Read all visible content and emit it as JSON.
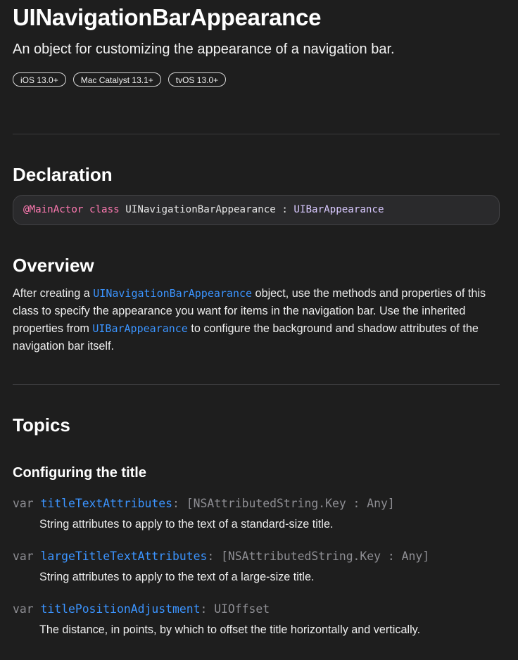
{
  "header": {
    "title": "UINavigationBarAppearance",
    "abstract": "An object for customizing the appearance of a navigation bar.",
    "platforms": [
      "iOS 13.0+",
      "Mac Catalyst 13.1+",
      "tvOS 13.0+"
    ]
  },
  "declaration": {
    "heading": "Declaration",
    "attribute": "@MainActor",
    "keyword": "class",
    "class_name": "UINavigationBarAppearance",
    "separator": ":",
    "superclass": "UIBarAppearance"
  },
  "overview": {
    "heading": "Overview",
    "text_1": "After creating a ",
    "link_1": "UINavigationBarAppearance",
    "text_2": " object, use the methods and properties of this class to specify the appearance you want for items in the navigation bar. Use the inherited properties from ",
    "link_2": "UIBarAppearance",
    "text_3": " to configure the background and shadow attributes of the navigation bar itself."
  },
  "topics": {
    "heading": "Topics",
    "group_title": "Configuring the title",
    "items": [
      {
        "keyword": "var",
        "name": "titleTextAttributes",
        "type": ": [NSAttributedString.Key : Any]",
        "description": "String attributes to apply to the text of a standard-size title."
      },
      {
        "keyword": "var",
        "name": "largeTitleTextAttributes",
        "type": ": [NSAttributedString.Key : Any]",
        "description": "String attributes to apply to the text of a large-size title."
      },
      {
        "keyword": "var",
        "name": "titlePositionAdjustment",
        "type": ": UIOffset",
        "description": "The distance, in points, by which to offset the title horizontally and vertically."
      }
    ]
  },
  "colors": {
    "background": "#1e1e1e",
    "link": "#3b94ff",
    "keyword": "#ff7ab2",
    "type_name": "#d9c9ff",
    "muted": "#8e8e93"
  }
}
